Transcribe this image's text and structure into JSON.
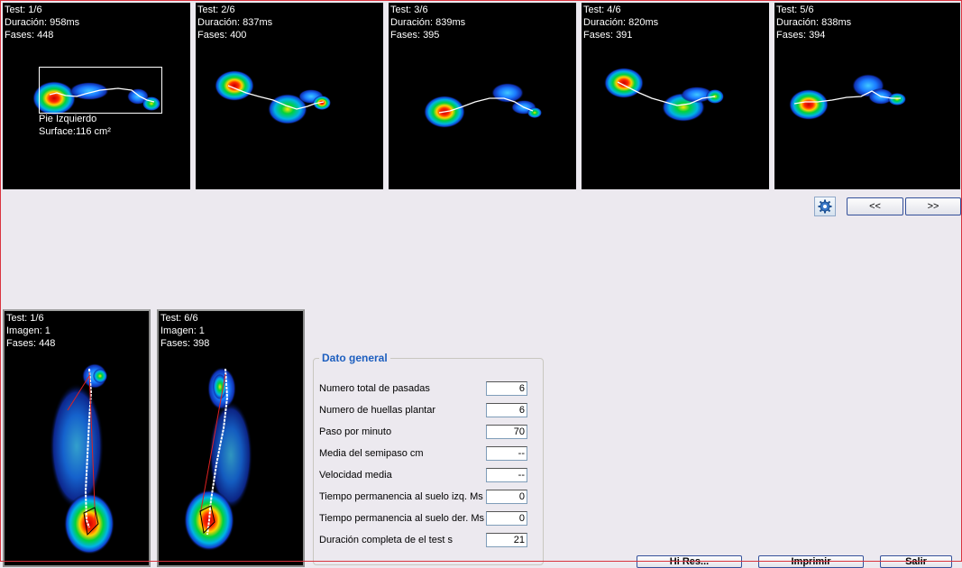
{
  "tests": [
    {
      "line1": "Test: 1/6",
      "line2": "Duración: 958ms",
      "line3": "Fases: 448",
      "foot_label": "Pie Izquierdo",
      "surface": "Surface:116 cm²"
    },
    {
      "line1": "Test: 2/6",
      "line2": "Duración: 837ms",
      "line3": "Fases: 400"
    },
    {
      "line1": "Test: 3/6",
      "line2": "Duración: 839ms",
      "line3": "Fases: 395"
    },
    {
      "line1": "Test: 4/6",
      "line2": "Duración: 820ms",
      "line3": "Fases: 391"
    },
    {
      "line1": "Test: 5/6",
      "line2": "Duración: 838ms",
      "line3": "Fases: 394"
    }
  ],
  "nav": {
    "prev_label": "<<",
    "next_label": ">>",
    "settings_icon": "gear-icon"
  },
  "bottom_tests": [
    {
      "line1": "Test: 1/6",
      "line2": "Imagen: 1",
      "line3": "Fases: 448"
    },
    {
      "line1": "Test: 6/6",
      "line2": "Imagen: 1",
      "line3": "Fases: 398"
    }
  ],
  "general": {
    "title": "Dato general",
    "rows": [
      {
        "label": "Numero total de pasadas",
        "value": "6"
      },
      {
        "label": "Numero de huellas plantar",
        "value": "6"
      },
      {
        "label": "Paso por minuto",
        "value": "70"
      },
      {
        "label": "Media del semipaso cm",
        "value": "--"
      },
      {
        "label": "Velocidad media",
        "value": "--"
      },
      {
        "label": "Tiempo permanencia al suelo izq. Ms",
        "value": "0"
      },
      {
        "label": "Tiempo permanencia al suelo der. Ms",
        "value": "0"
      },
      {
        "label": "Duración completa de el test s",
        "value": "21"
      }
    ]
  },
  "bottom_buttons": [
    {
      "label": "Hi Res..."
    },
    {
      "label": "Imprimir"
    },
    {
      "label": "Salir"
    }
  ],
  "colors": {
    "heat_high": "#ff2a00",
    "heat_mid": "#ffd200",
    "heat_green": "#00d23c",
    "heat_blue": "#1070ff",
    "background": "#000000",
    "accent": "#1d5fbf"
  }
}
